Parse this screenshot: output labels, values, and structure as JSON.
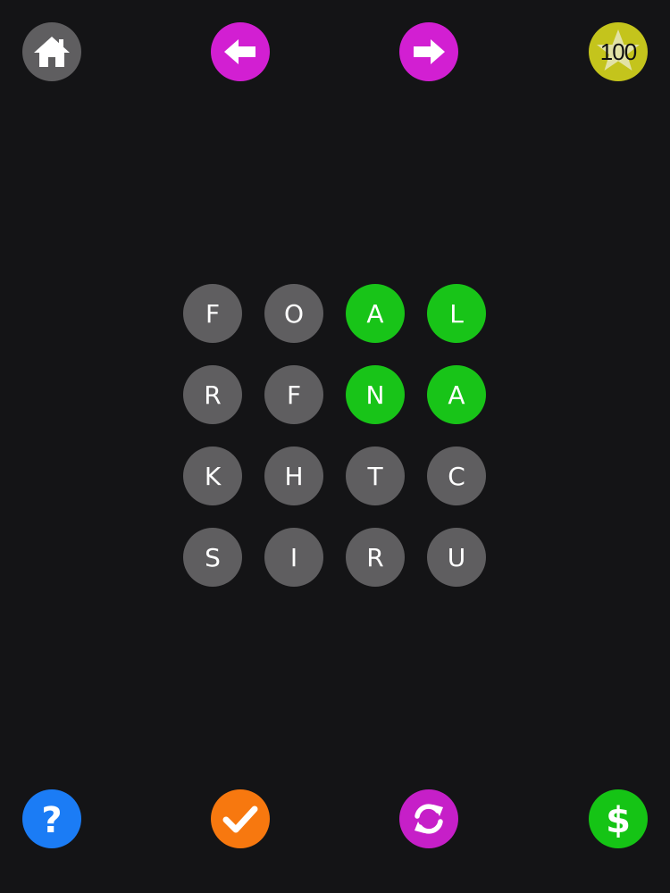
{
  "colors": {
    "background": "#141416",
    "tile": "#5f5e60",
    "tile_selected": "#18c418",
    "home": "#5f5e60",
    "nav_arrows": "#d21fd2",
    "coins": "#c4c41c",
    "help": "#1b7cf5",
    "check": "#f7780f",
    "shuffle": "#c61fc8",
    "shop": "#15c415"
  },
  "header": {
    "home_icon": "house-icon",
    "back_icon": "arrow-left-icon",
    "next_icon": "arrow-right-icon",
    "coins": {
      "icon": "star-icon",
      "count": "100"
    }
  },
  "grid": {
    "tiles": [
      {
        "letter": "F",
        "selected": false
      },
      {
        "letter": "O",
        "selected": false
      },
      {
        "letter": "A",
        "selected": true
      },
      {
        "letter": "L",
        "selected": true
      },
      {
        "letter": "R",
        "selected": false
      },
      {
        "letter": "F",
        "selected": false
      },
      {
        "letter": "N",
        "selected": true
      },
      {
        "letter": "A",
        "selected": true
      },
      {
        "letter": "K",
        "selected": false
      },
      {
        "letter": "H",
        "selected": false
      },
      {
        "letter": "T",
        "selected": false
      },
      {
        "letter": "C",
        "selected": false
      },
      {
        "letter": "S",
        "selected": false
      },
      {
        "letter": "I",
        "selected": false
      },
      {
        "letter": "R",
        "selected": false
      },
      {
        "letter": "U",
        "selected": false
      }
    ]
  },
  "footer": {
    "help": {
      "label": "?",
      "icon": "question-icon"
    },
    "check_icon": "checkmark-icon",
    "shuffle_icon": "refresh-icon",
    "shop": {
      "label": "$",
      "icon": "dollar-icon"
    }
  }
}
